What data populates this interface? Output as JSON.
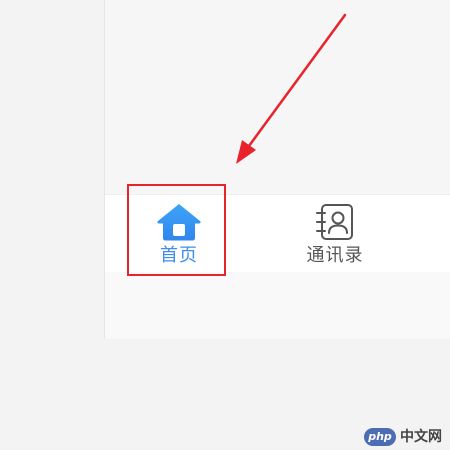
{
  "tabbar": {
    "tabs": [
      {
        "label": "首页",
        "icon": "home-icon",
        "active": true,
        "color": "#3d8ef0"
      },
      {
        "label": "通讯录",
        "icon": "contacts-book-icon",
        "active": false,
        "color": "#555555"
      }
    ]
  },
  "annotation": {
    "box_color": "#e8232b",
    "arrow_color": "#e8232b"
  },
  "watermark": {
    "badge": "php",
    "text": "中文网"
  }
}
